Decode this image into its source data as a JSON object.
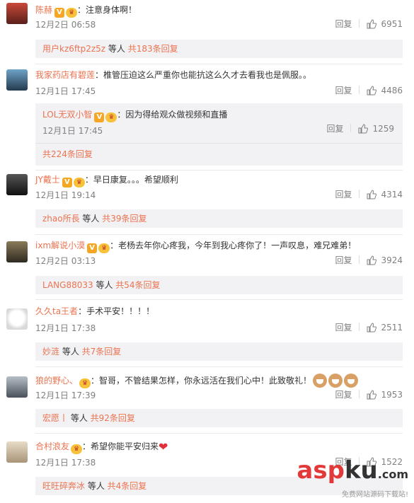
{
  "ui": {
    "reply_label": "回复",
    "accent": "#eb7350"
  },
  "comments": [
    {
      "user": "陈赫",
      "text": "：注意身体啊！",
      "time": "12月2日 06:58",
      "likes": "6951",
      "replies": {
        "who": "用户kz6ftp2z5z",
        "etc": " 等人 ",
        "count": "共183条回复"
      }
    },
    {
      "user": "我家药店有碧莲",
      "text": "：椎管压迫这么严重你也能抗这么久才去看我也是佩服。。",
      "time": "12月1日 17:45",
      "likes": "4486",
      "sub": {
        "user": "LOL无双小智",
        "text": "：因为得给观众做视频和直播",
        "time": "12月1日 17:45",
        "likes": "1259"
      },
      "replies": {
        "count": "共224条回复"
      }
    },
    {
      "user": "JY戴士",
      "text": "：早日康复。。。希望顺利",
      "time": "12月1日 19:14",
      "likes": "4314",
      "replies": {
        "who": "zhao所長",
        "etc": " 等人 ",
        "count": "共39条回复"
      }
    },
    {
      "user": "ixm解说小漠",
      "text": "：老杨去年你心疼我，今年到我心疼你了！一声叹息，难兄难弟！",
      "time": "12月2日 03:13",
      "likes": "3924",
      "replies": {
        "who": "LANG88033",
        "etc": " 等人 ",
        "count": "共54条回复"
      }
    },
    {
      "user": "久久ta王者",
      "text": "：手术平安！！！！",
      "time": "12月1日 17:38",
      "likes": "2511",
      "replies": {
        "who": "妙涟",
        "etc": " 等人 ",
        "count": "共7条回复"
      }
    },
    {
      "user": "狼的野心、",
      "text": "：智哥，不管结果怎样，你永远活在我们心中！此致敬礼！",
      "time": "12月1日 17:39",
      "likes": "1953",
      "replies": {
        "who": "宏愿丨",
        "etc": " 等人 ",
        "count": "共92条回复"
      }
    },
    {
      "user": "合村浪友",
      "text": "：希望你能平安归来",
      "time": "12月1日 17:38",
      "likes": "1522",
      "replies": {
        "who": "旺旺碎奔冰",
        "etc": " 等人 ",
        "count": "共4条回复"
      }
    }
  ],
  "watermark": {
    "logo_a": "asp",
    "logo_b": "ku",
    "logo_c": ".com",
    "sub": "免费网站源码下载站!"
  }
}
